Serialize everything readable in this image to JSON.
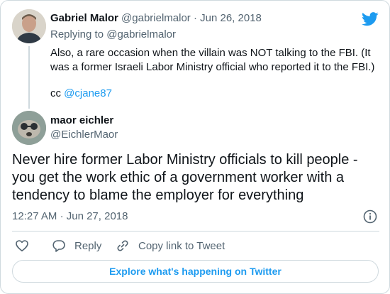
{
  "parent_tweet": {
    "author_name": "Gabriel Malor",
    "author_handle": "@gabrielmalor",
    "separator": "·",
    "date": "Jun 26, 2018",
    "replying_prefix": "Replying to ",
    "replying_to": "@gabrielmalor",
    "text": "Also, a rare occasion when the villain was NOT talking to the FBI. (It was a former Israeli Labor Ministry official who reported it to the FBI.)",
    "cc_prefix": "cc ",
    "cc_handle": "@cjane87"
  },
  "main_tweet": {
    "author_name": "maor eichler",
    "author_handle": "@EichlerMaor",
    "text": "Never hire former Labor Ministry officials to kill people - you get the work ethic of a government worker with a tendency to blame the employer for everything",
    "time": "12:27 AM",
    "separator": "·",
    "date": "Jun 27, 2018"
  },
  "actions": {
    "reply_label": "Reply",
    "copy_label": "Copy link to Tweet"
  },
  "explore_label": "Explore what's happening on Twitter",
  "icons": {
    "brand": "twitter-bird-icon",
    "info": "info-icon",
    "like": "heart-icon",
    "reply": "reply-bubble-icon",
    "copy": "link-icon"
  },
  "colors": {
    "accent": "#1d9bf0",
    "text": "#0f1419",
    "muted": "#536471",
    "border": "#cfd9de"
  }
}
